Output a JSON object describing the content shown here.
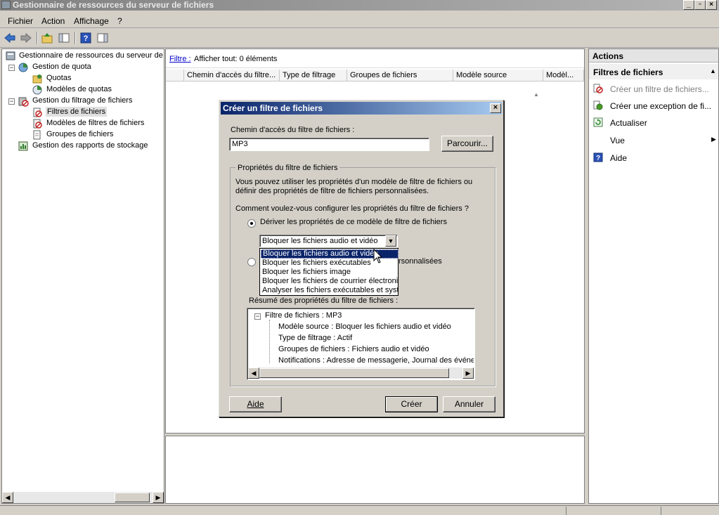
{
  "window": {
    "title": "Gestionnaire de ressources du serveur de fichiers",
    "controls": [
      "_",
      "▫",
      "×"
    ]
  },
  "menu": [
    "Fichier",
    "Action",
    "Affichage",
    "?"
  ],
  "tree": {
    "root": "Gestionnaire de ressources du serveur de",
    "items": [
      {
        "label": "Gestion de quota"
      },
      {
        "label": "Quotas"
      },
      {
        "label": "Modèles de quotas"
      },
      {
        "label": "Gestion du filtrage de fichiers"
      },
      {
        "label": "Filtres de fichiers"
      },
      {
        "label": "Modèles de filtres de fichiers"
      },
      {
        "label": "Groupes de fichiers"
      },
      {
        "label": "Gestion des rapports de stockage"
      }
    ]
  },
  "filterbar": {
    "link": "Filtre :",
    "text": "Afficher tout: 0 éléments"
  },
  "columns": [
    "Chemin d'accès du filtre...",
    "Type de filtrage",
    "Groupes de fichiers",
    "Modèle source",
    "Modèl..."
  ],
  "actions": {
    "header": "Actions",
    "section": "Filtres de fichiers",
    "items": [
      {
        "label": "Créer un filtre de fichiers..."
      },
      {
        "label": "Créer une exception de fi..."
      },
      {
        "label": "Actualiser"
      },
      {
        "label": "Vue"
      },
      {
        "label": "Aide"
      }
    ]
  },
  "dialog": {
    "title": "Créer un filtre de fichiers",
    "path_label": "Chemin d'accès du filtre de fichiers :",
    "path_value": "MP3",
    "browse": "Parcourir...",
    "group_title": "Propriétés du filtre de fichiers",
    "intro1": "Vous pouvez utiliser les propriétés d'un modèle de filtre de fichiers ou",
    "intro2": "définir des propriétés de filtre de fichiers personnalisées.",
    "question": "Comment voulez-vous configurer les propriétés du filtre de fichiers ?",
    "radio1": "Dériver les propriétés de ce modèle de filtre de fichiers",
    "radio2_tail": "rsonnalisées",
    "combo_value": "Bloquer les fichiers audio et vidéo",
    "dropdown": [
      "Bloquer les fichiers audio et vidéo",
      "Bloquer les fichiers exécutables",
      "Bloquer les fichiers image",
      "Bloquer les fichiers de courrier électroniqu",
      "Analyser les fichiers exécutables et systèm"
    ],
    "summary_label": "Résumé des propriétés du filtre de fichiers :",
    "summary": {
      "root": "Filtre de fichiers : MP3",
      "lines": [
        "Modèle source : Bloquer les fichiers audio et vidéo",
        "Type de filtrage : Actif",
        "Groupes de fichiers : Fichiers audio et vidéo",
        "Notifications : Adresse de messagerie, Journal des événem"
      ]
    },
    "help": "Aide",
    "create": "Créer",
    "cancel": "Annuler"
  }
}
